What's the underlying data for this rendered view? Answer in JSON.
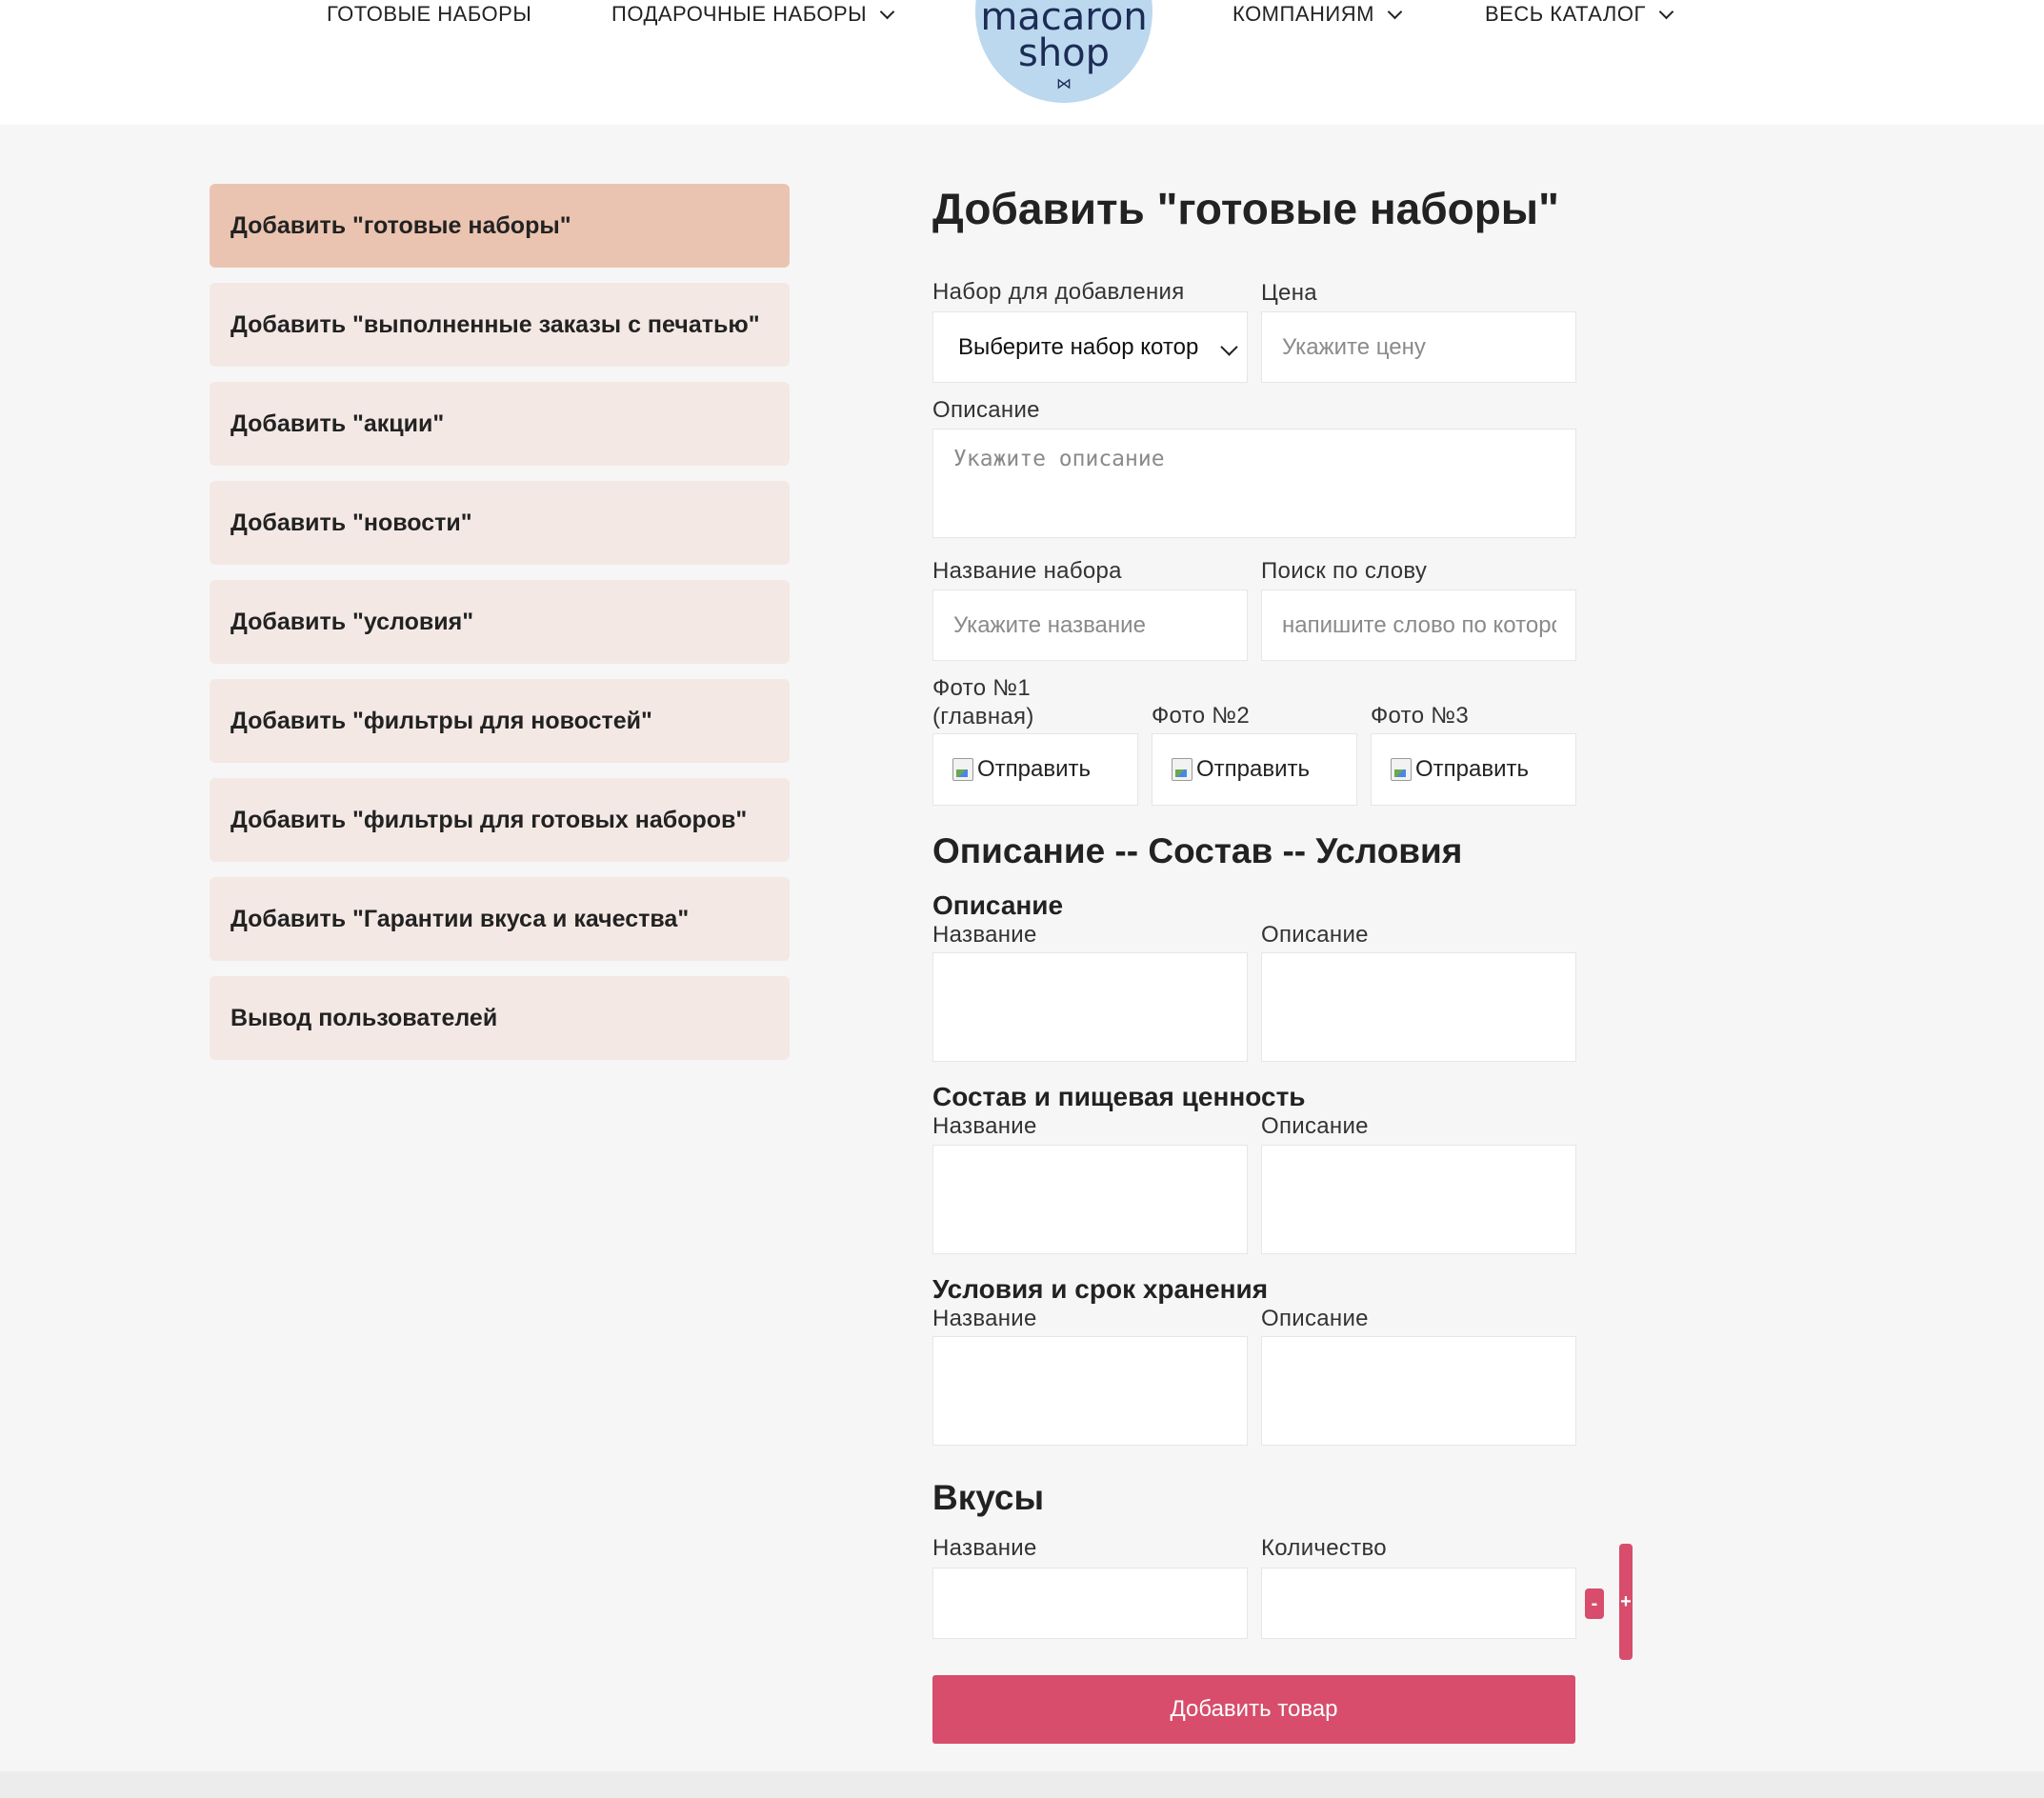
{
  "header": {
    "nav_left": [
      {
        "label": "ГОТОВЫЕ НАБОРЫ",
        "has_dropdown": false
      },
      {
        "label": "ПОДАРОЧНЫЕ НАБОРЫ",
        "has_dropdown": true
      }
    ],
    "nav_right": [
      {
        "label": "КОМПАНИЯМ",
        "has_dropdown": true
      },
      {
        "label": "ВЕСЬ КАТАЛОГ",
        "has_dropdown": true
      }
    ],
    "logo": {
      "line1": "macaron",
      "line2": "shop",
      "bow": "⋈"
    }
  },
  "sidebar": {
    "items": [
      {
        "label": "Добавить \"готовые наборы\"",
        "active": true
      },
      {
        "label": "Добавить \"выполненные заказы с печатью\"",
        "active": false
      },
      {
        "label": "Добавить \"акции\"",
        "active": false
      },
      {
        "label": "Добавить \"новости\"",
        "active": false
      },
      {
        "label": "Добавить \"условия\"",
        "active": false
      },
      {
        "label": "Добавить \"фильтры для новостей\"",
        "active": false
      },
      {
        "label": "Добавить \"фильтры для готовых наборов\"",
        "active": false
      },
      {
        "label": "Добавить \"Гарантии вкуса и качества\"",
        "active": false
      },
      {
        "label": "Вывод пользователей",
        "active": false
      }
    ]
  },
  "form": {
    "title": "Добавить \"готовые наборы\"",
    "set_label": "Набор для добавления",
    "set_select_value": "Выберите набор котор",
    "price_label": "Цена",
    "price_placeholder": "Укажите цену",
    "description_label": "Описание",
    "description_placeholder": "Укажите описание",
    "name_label": "Название набора",
    "name_placeholder": "Укажите название",
    "search_label": "Поиск по слову",
    "search_placeholder": "напишите слово по которо",
    "photo1_label_line1": "Фото №1",
    "photo1_label_line2": "(главная)",
    "photo2_label": "Фото №2",
    "photo3_label": "Фото №3",
    "upload_label": "Отправить",
    "details_title": "Описание -- Состав -- Условия",
    "sections": [
      {
        "title": "Описание",
        "name_label": "Название",
        "desc_label": "Описание"
      },
      {
        "title": "Состав и пищевая ценность",
        "name_label": "Название",
        "desc_label": "Описание"
      },
      {
        "title": "Условия и срок хранения",
        "name_label": "Название",
        "desc_label": "Описание"
      }
    ],
    "flavors_title": "Вкусы",
    "flavor_name_label": "Название",
    "flavor_qty_label": "Количество",
    "minus_label": "-",
    "plus_label": "+",
    "submit_label": "Добавить товар"
  },
  "colors": {
    "accent": "#d74d6b",
    "sidebar_active": "#ebc4b1",
    "sidebar_item": "#f3e8e4",
    "logo": "#bcd8ef",
    "background": "#f6f6f6"
  }
}
